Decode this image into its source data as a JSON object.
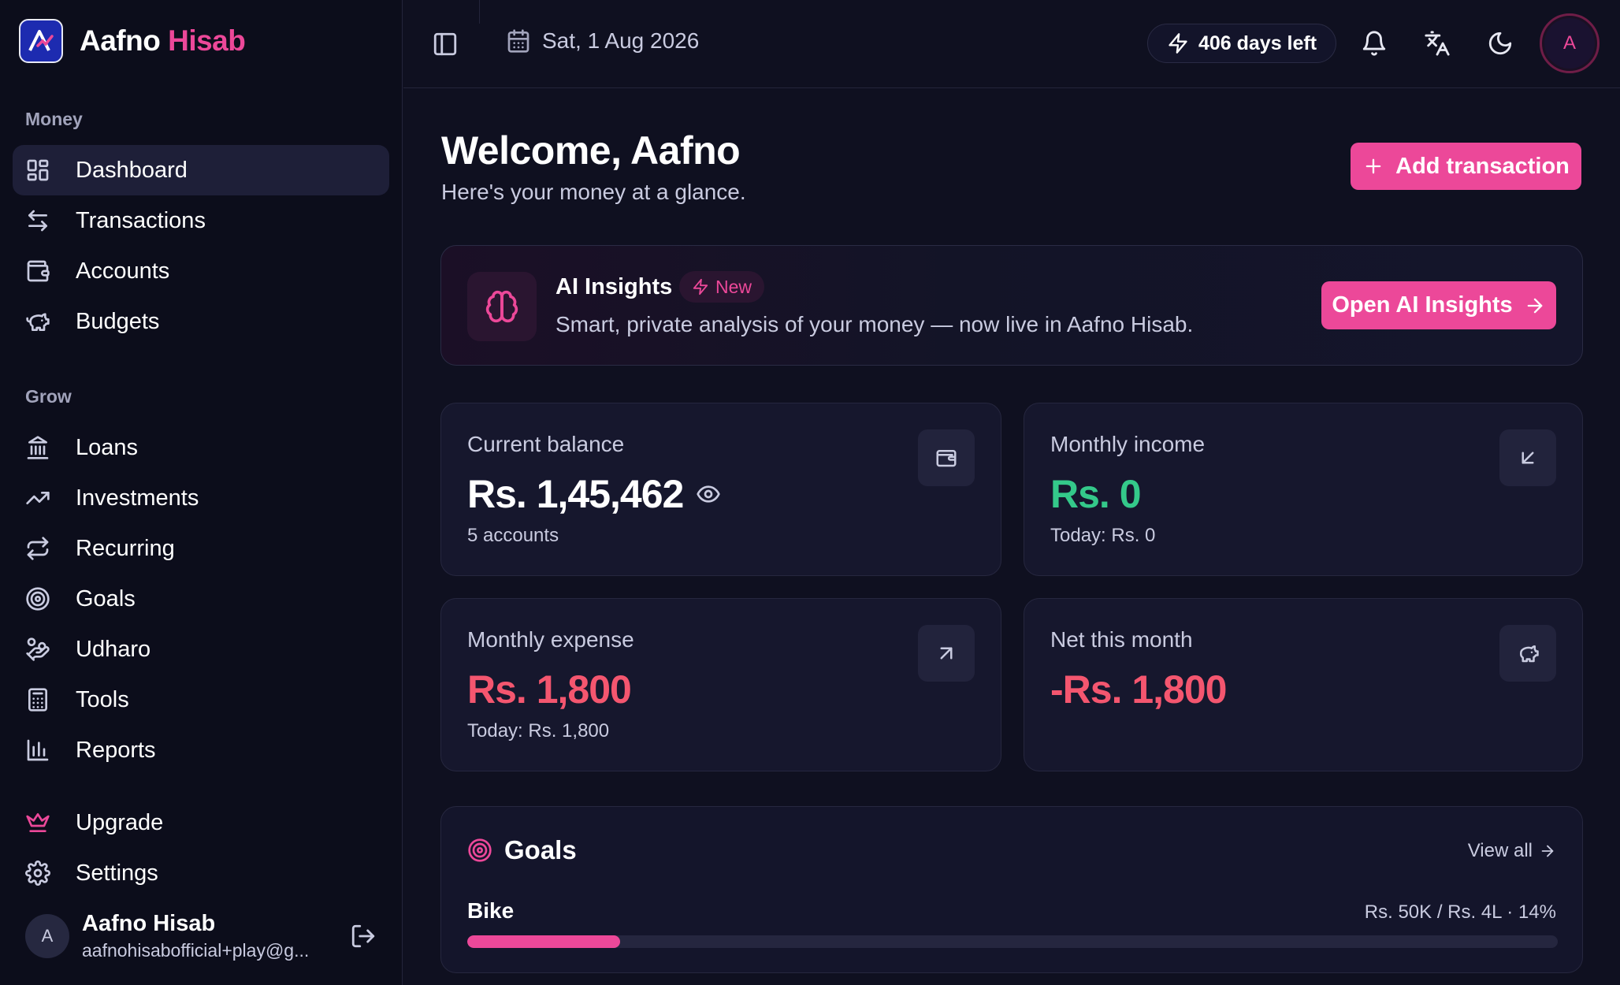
{
  "brand": {
    "name_part1": "Aafno",
    "name_part2": "Hisab",
    "accent_color": "#ec4899"
  },
  "sidebar": {
    "section_money": "Money",
    "section_grow": "Grow",
    "items": [
      {
        "label": "Dashboard",
        "icon": "dashboard-grid-icon",
        "active": true
      },
      {
        "label": "Transactions",
        "icon": "arrows-left-right-icon"
      },
      {
        "label": "Accounts",
        "icon": "wallet-icon"
      },
      {
        "label": "Budgets",
        "icon": "piggy-bank-icon"
      },
      {
        "label": "Loans",
        "icon": "bank-icon"
      },
      {
        "label": "Investments",
        "icon": "trending-up-icon"
      },
      {
        "label": "Recurring",
        "icon": "repeat-icon"
      },
      {
        "label": "Goals",
        "icon": "target-icon"
      },
      {
        "label": "Udharo",
        "icon": "hand-coins-icon"
      },
      {
        "label": "Tools",
        "icon": "calculator-icon"
      },
      {
        "label": "Reports",
        "icon": "bar-chart-icon"
      },
      {
        "label": "Upgrade",
        "icon": "crown-icon"
      },
      {
        "label": "Settings",
        "icon": "gear-icon"
      }
    ],
    "user": {
      "initial": "A",
      "name": "Aafno Hisab",
      "email": "aafnohisabofficial+play@g..."
    }
  },
  "topbar": {
    "date": "Sat, 1 Aug 2026",
    "days_left": "406 days left",
    "avatar_initial": "A"
  },
  "main": {
    "welcome": "Welcome, Aafno",
    "subtitle": "Here's your money at a glance.",
    "add_button": "Add transaction",
    "ai": {
      "title": "AI Insights",
      "badge": "New",
      "description": "Smart, private analysis of your money — now live in Aafno Hisab.",
      "button": "Open AI Insights"
    },
    "stats": {
      "balance": {
        "label": "Current balance",
        "value": "Rs. 1,45,462",
        "sub": "5 accounts"
      },
      "income": {
        "label": "Monthly income",
        "value": "Rs. 0",
        "sub": "Today: Rs. 0"
      },
      "expense": {
        "label": "Monthly expense",
        "value": "Rs. 1,800",
        "sub": "Today: Rs. 1,800"
      },
      "net": {
        "label": "Net this month",
        "value": "-Rs. 1,800"
      }
    },
    "goals": {
      "title": "Goals",
      "view_all": "View all",
      "items": [
        {
          "name": "Bike",
          "meta": "Rs. 50K / Rs. 4L · 14%",
          "progress": 0.14
        }
      ]
    }
  },
  "colors": {
    "accent": "#ec4899",
    "positive": "#34c98a",
    "negative": "#f4566f",
    "background": "#0f1020"
  }
}
